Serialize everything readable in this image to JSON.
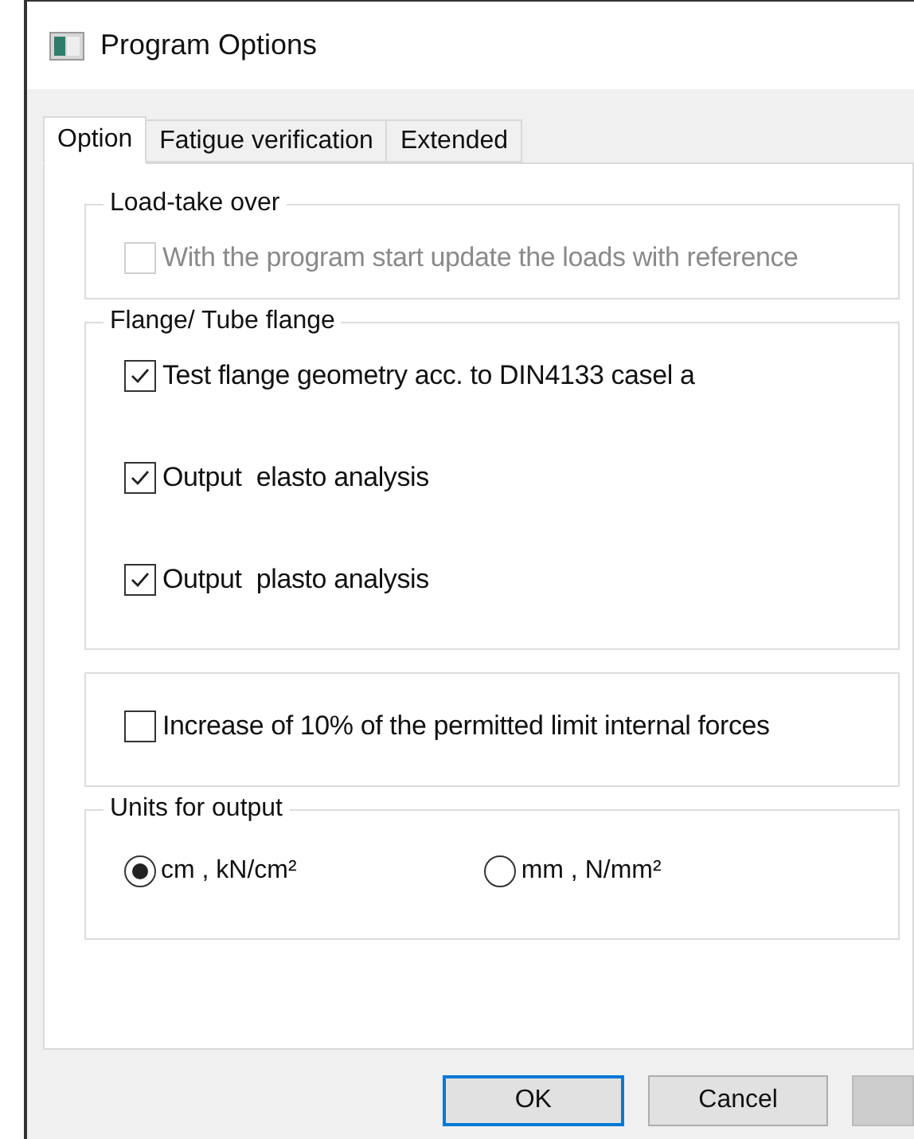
{
  "window": {
    "title": "Program Options"
  },
  "tabs": [
    {
      "label": "Option",
      "selected": true
    },
    {
      "label": "Fatigue verification",
      "selected": false
    },
    {
      "label": "Extended",
      "selected": false
    }
  ],
  "groups": [
    {
      "title": "Load-take over",
      "kind": "checks",
      "items": [
        {
          "label": "With the program start update the loads with reference",
          "checked": false,
          "disabled": true
        }
      ]
    },
    {
      "title": "Flange/ Tube flange",
      "kind": "checks",
      "items": [
        {
          "label": "Test flange geometry acc. to DIN4133 casel a",
          "checked": true,
          "disabled": false
        },
        {
          "label": "Output  elasto analysis",
          "checked": true,
          "disabled": false
        },
        {
          "label": "Output  plasto analysis",
          "checked": true,
          "disabled": false
        }
      ]
    },
    {
      "kind": "checks",
      "items": [
        {
          "label": "Increase of 10% of the permitted limit internal forces",
          "checked": false,
          "disabled": false
        }
      ]
    },
    {
      "title": "Units for output",
      "kind": "radios",
      "items": [
        {
          "label": "cm , kN/cm²",
          "selected": true
        },
        {
          "label": "mm , N/mm²",
          "selected": false
        }
      ]
    }
  ],
  "buttons": [
    {
      "label": "OK",
      "default": true
    },
    {
      "label": "Cancel",
      "default": false
    }
  ]
}
